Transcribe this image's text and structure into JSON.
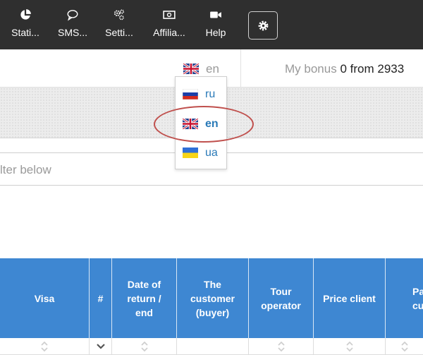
{
  "nav": {
    "items": [
      {
        "label": "Stati...",
        "icon": "pie-chart-icon"
      },
      {
        "label": "SMS...",
        "icon": "chat-bubble-icon"
      },
      {
        "label": "Setti...",
        "icon": "gears-icon"
      },
      {
        "label": "Affilia...",
        "icon": "money-bill-icon"
      },
      {
        "label": "Help",
        "icon": "video-camera-icon"
      }
    ],
    "settings_icon": "gear-icon"
  },
  "language": {
    "current": "en",
    "options": [
      {
        "code": "ru",
        "flag": "russia-flag-icon"
      },
      {
        "code": "en",
        "flag": "uk-flag-icon"
      },
      {
        "code": "ua",
        "flag": "ukraine-flag-icon"
      }
    ]
  },
  "bonus": {
    "label": "My bonus",
    "value": "0",
    "from_label": "from",
    "total": "2933"
  },
  "filter": {
    "hint": "lter below"
  },
  "table": {
    "columns": [
      "Visa",
      "#",
      "Date of\nreturn /\nend",
      "The\ncustomer\n(buyer)",
      "Tour\noperator",
      "Price client",
      "Pa\ncusto"
    ]
  },
  "colors": {
    "nav_bg": "#2f2f2f",
    "table_header": "#3e87d2",
    "link": "#2a7ab8",
    "highlight": "#c0504d"
  }
}
